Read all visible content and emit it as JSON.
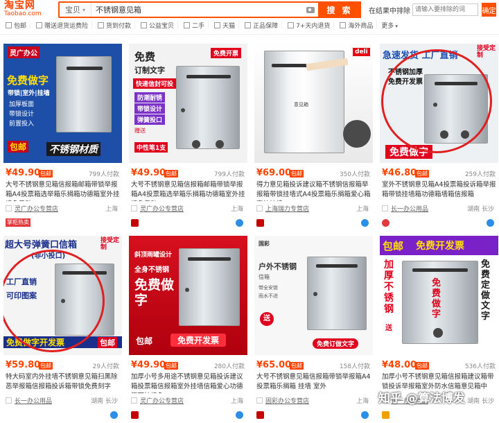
{
  "header": {
    "logo_main": "淘宝网",
    "logo_sub": "Taobao.com",
    "search_scope": "宝贝",
    "search_query": "不锈钢意见箱",
    "search_button": "搜 索",
    "exclude_label": "在结果中排除",
    "exclude_placeholder": "请输入要排除的词",
    "exclude_button": "确定"
  },
  "filters": [
    "包邮",
    "赠送退货运费险",
    "货到付款",
    "公益宝贝",
    "二手",
    "天猫",
    "正品保障",
    "7+天内退货",
    "海外商品"
  ],
  "filters_more": "更多",
  "products": [
    {
      "price": "¥49.90",
      "baoyou": "包邮",
      "deals": "799人付款",
      "title": "大号不锈钢意见箱信报箱邮箱带锁举报箱A4投票箱选举箱乐捐箱功德箱室外挂墙免费贴",
      "shop": "灵广办公专营店",
      "location": "上海",
      "tag": "掌柜热卖",
      "image": {
        "brand": "灵广办公",
        "headline": "免费做字",
        "sub": "带锁|室外|挂墙",
        "bullets": [
          "加厚板面",
          "带锁设计",
          "前置投入"
        ],
        "tag": "包邮",
        "banner": "不锈钢材质"
      }
    },
    {
      "price": "¥49.90",
      "baoyou": "包邮",
      "deals": "799人付款",
      "title": "大号不锈钢意见箱信报箱邮箱带锁举报箱A4投票箱选举箱乐捐箱功德箱室外挂墙免费贴",
      "shop": "灵广办公专营店",
      "location": "上海",
      "image": {
        "headline": "免费",
        "sub": "订制文字",
        "corner": "免费开票",
        "stripe": "快递信封可投",
        "bullets": [
          "防潮耐锈",
          "带锁设计",
          "弹簧投口"
        ],
        "note": "赠送",
        "note2": "中性笔1支"
      }
    },
    {
      "price": "¥69.00",
      "baoyou": "包邮",
      "deals": "350人付款",
      "title": "得力意见箱投诉建议箱不锈钢信报箱举报箱带锁挂墙式A4投票箱乐捐箱爱心箱室外挂墙",
      "shop": "上海瑞力专营店",
      "location": "上海",
      "image": {
        "brand": "deli",
        "label": "意见箱"
      }
    },
    {
      "price": "¥46.80",
      "baoyou": "包邮",
      "deals": "259人付款",
      "title": "室外不锈钢意见箱A4投票箱投诉箱举报箱带锁挂墙箱功德箱墙箱信报箱",
      "shop": "长一办公用品",
      "location": "湖南 长沙",
      "image": {
        "headline": "急速发货 工厂直销",
        "corner": "接受定制",
        "bullets": [
          "不锈钢加厚",
          "免费开发票"
        ],
        "banner": "免费做字"
      }
    },
    {
      "price": "¥59.80",
      "baoyou": "包邮",
      "deals": "29人付款",
      "title": "特大码室内外挂墙不锈钢意见箱扫黑除恶举报箱信报箱投诉箱带锁免费刻字",
      "shop": "长一办公用品",
      "location": "湖南 长沙",
      "image": {
        "headline": "超大号弹簧口信箱",
        "sub": "(非小投口)",
        "corner": "接受定制",
        "bullets": [
          "工厂直销",
          "可印图案"
        ],
        "banner": "免费做字开发票",
        "tag": "包邮"
      }
    },
    {
      "price": "¥49.90",
      "baoyou": "包邮",
      "deals": "280人付款",
      "title": "加厚小号多用途不锈钢意见箱投诉建议箱投票箱信报箱室外挂墙信箱爱心功德箱可挂墙免",
      "shop": "灵广办公专营店",
      "location": "上海",
      "image": {
        "stripe": "斜顶雨罐设计",
        "sub": "全身不锈钢",
        "headline": "免费做字",
        "tag": "包邮",
        "banner": "免费开发票"
      }
    },
    {
      "price": "¥65.00",
      "baoyou": "包邮",
      "deals": "158人付款",
      "title": "大号不锈钢意见箱信报箱带锁举报箱A4投票箱乐捐箱 挂墙 室外",
      "shop": "固彩办公专营店",
      "location": "上海",
      "image": {
        "brand": "国彩",
        "headline": "户外不锈钢",
        "sub": "信箱",
        "bullets": [
          "带全安锁",
          "雨水不进"
        ],
        "note": "送",
        "banner": "免费订做文字"
      }
    },
    {
      "price": "¥48.00",
      "baoyou": "包邮",
      "deals": "536人付款",
      "title": "加厚小号不锈钢意见箱信报箱建议箱带锁投诉举报箱室外防水信箱意见箱中",
      "shop": "长一办公用品",
      "location": "湖南 长沙",
      "image": {
        "tag": "包邮",
        "banner": "免费开发票",
        "left": "加厚不锈钢",
        "right": "免费定做文字",
        "box_text": "免费做字",
        "note": "送"
      }
    }
  ],
  "watermark": "知乎 @算法博发",
  "colors": {
    "accent": "#ff5000",
    "price": "#ff4400",
    "tmall": "#c40000"
  }
}
